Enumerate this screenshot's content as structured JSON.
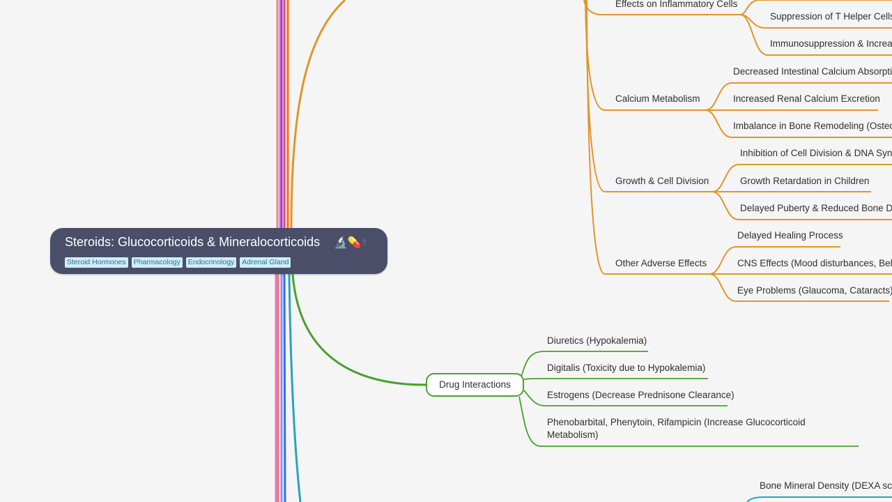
{
  "root": {
    "title": "Steroids: Glucocorticoids & Mineralocorticoids",
    "icons": [
      "microscope-icon",
      "pill-icon",
      "caduceus-icon"
    ],
    "icons_text": "🔬💊⚕",
    "tags": [
      "Steroid Hormones",
      "Pharmacology",
      "Endocrinology",
      "Adrenal Gland"
    ]
  },
  "colors": {
    "root_bg": "#4a4e69",
    "adverse_branch": "#e0962a",
    "drug_branch": "#4aa02c",
    "monitoring_branch": "#29a3b8",
    "trunk_lines": [
      "#e08a8a",
      "#e879c8",
      "#9b3ef0",
      "#e84a6a",
      "#ff6a1a",
      "#e879c8",
      "#f07878",
      "#8f8ff5",
      "#2f6fef",
      "#29a3b8"
    ]
  },
  "adverse_effects": {
    "groups": [
      {
        "label": "Effects on Inflammatory Cells",
        "children": [
          "Suppression of T Helper Cells",
          "Immunosuppression & Increa"
        ]
      },
      {
        "label": "Calcium Metabolism",
        "children": [
          "Decreased Intestinal Calcium Absorpti",
          "Increased Renal Calcium Excretion",
          "Imbalance in Bone Remodeling (Osteo"
        ]
      },
      {
        "label": "Growth & Cell Division",
        "children": [
          "Inhibition of Cell Division & DNA Synt",
          "Growth Retardation in Children",
          "Delayed Puberty & Reduced Bone De"
        ]
      },
      {
        "label": "Other Adverse Effects",
        "children": [
          "Delayed Healing Process",
          "CNS Effects (Mood disturbances, Beha",
          "Eye Problems (Glaucoma, Cataracts)"
        ]
      }
    ]
  },
  "drug_interactions": {
    "label": "Drug Interactions",
    "children": [
      "Diuretics (Hypokalemia)",
      "Digitalis (Toxicity due to Hypokalemia)",
      "Estrogens (Decrease Prednisone Clearance)",
      "Phenobarbital, Phenytoin, Rifampicin (Increase Glucocorticoid Metabolism)"
    ]
  },
  "monitoring": {
    "children": [
      "Bone Mineral Density (DEXA scar"
    ]
  }
}
